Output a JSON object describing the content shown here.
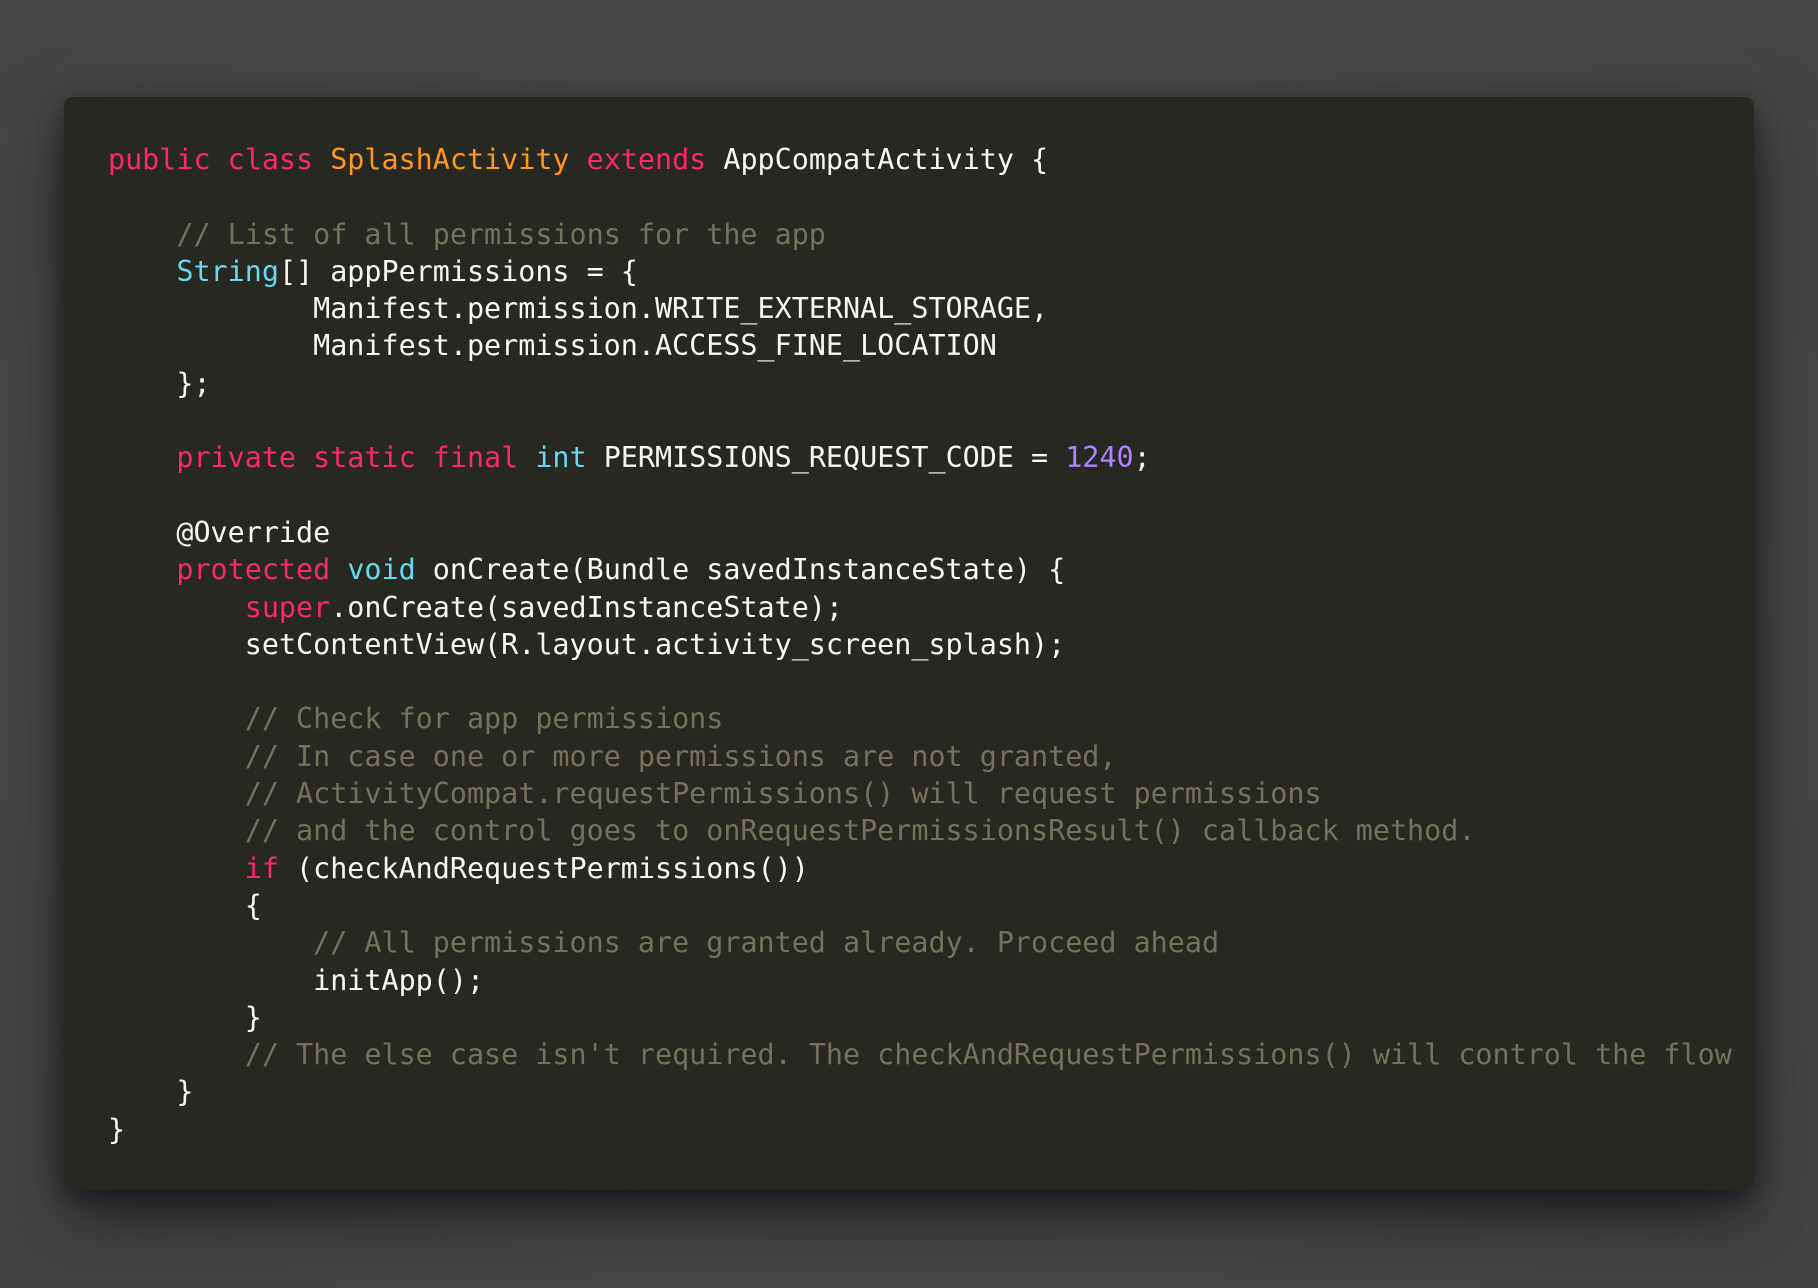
{
  "colors": {
    "background": "#4a4a4a",
    "editor_background": "#272822",
    "keyword": "#f92672",
    "class_name": "#fd971f",
    "type": "#66d9ef",
    "number": "#ae81ff",
    "comment": "#75715e",
    "plain": "#f8f8f2"
  },
  "code": {
    "language": "java",
    "lines": [
      [
        {
          "t": "kw",
          "v": "public"
        },
        {
          "t": "plain",
          "v": " "
        },
        {
          "t": "kw",
          "v": "class"
        },
        {
          "t": "plain",
          "v": " "
        },
        {
          "t": "cls",
          "v": "SplashActivity"
        },
        {
          "t": "plain",
          "v": " "
        },
        {
          "t": "kw",
          "v": "extends"
        },
        {
          "t": "plain",
          "v": " AppCompatActivity {"
        }
      ],
      [],
      [
        {
          "t": "plain",
          "v": "    "
        },
        {
          "t": "cmt",
          "v": "// List of all permissions for the app"
        }
      ],
      [
        {
          "t": "plain",
          "v": "    "
        },
        {
          "t": "typ",
          "v": "String"
        },
        {
          "t": "plain",
          "v": "[] appPermissions = {"
        }
      ],
      [
        {
          "t": "plain",
          "v": "            Manifest.permission.WRITE_EXTERNAL_STORAGE,"
        }
      ],
      [
        {
          "t": "plain",
          "v": "            Manifest.permission.ACCESS_FINE_LOCATION"
        }
      ],
      [
        {
          "t": "plain",
          "v": "    };"
        }
      ],
      [],
      [
        {
          "t": "plain",
          "v": "    "
        },
        {
          "t": "kw",
          "v": "private"
        },
        {
          "t": "plain",
          "v": " "
        },
        {
          "t": "kw",
          "v": "static"
        },
        {
          "t": "plain",
          "v": " "
        },
        {
          "t": "kw",
          "v": "final"
        },
        {
          "t": "plain",
          "v": " "
        },
        {
          "t": "typ",
          "v": "int"
        },
        {
          "t": "plain",
          "v": " PERMISSIONS_REQUEST_CODE = "
        },
        {
          "t": "num",
          "v": "1240"
        },
        {
          "t": "plain",
          "v": ";"
        }
      ],
      [],
      [
        {
          "t": "plain",
          "v": "    @Override"
        }
      ],
      [
        {
          "t": "plain",
          "v": "    "
        },
        {
          "t": "kw",
          "v": "protected"
        },
        {
          "t": "plain",
          "v": " "
        },
        {
          "t": "typ",
          "v": "void"
        },
        {
          "t": "plain",
          "v": " onCreate(Bundle savedInstanceState) {"
        }
      ],
      [
        {
          "t": "plain",
          "v": "        "
        },
        {
          "t": "kw",
          "v": "super"
        },
        {
          "t": "plain",
          "v": ".onCreate(savedInstanceState);"
        }
      ],
      [
        {
          "t": "plain",
          "v": "        setContentView(R.layout.activity_screen_splash);"
        }
      ],
      [],
      [
        {
          "t": "plain",
          "v": "        "
        },
        {
          "t": "cmt",
          "v": "// Check for app permissions"
        }
      ],
      [
        {
          "t": "plain",
          "v": "        "
        },
        {
          "t": "cmt",
          "v": "// In case one or more permissions are not granted,"
        }
      ],
      [
        {
          "t": "plain",
          "v": "        "
        },
        {
          "t": "cmt",
          "v": "// ActivityCompat.requestPermissions() will request permissions"
        }
      ],
      [
        {
          "t": "plain",
          "v": "        "
        },
        {
          "t": "cmt",
          "v": "// and the control goes to onRequestPermissionsResult() callback method."
        }
      ],
      [
        {
          "t": "plain",
          "v": "        "
        },
        {
          "t": "kw",
          "v": "if"
        },
        {
          "t": "plain",
          "v": " (checkAndRequestPermissions())"
        }
      ],
      [
        {
          "t": "plain",
          "v": "        {"
        }
      ],
      [
        {
          "t": "plain",
          "v": "            "
        },
        {
          "t": "cmt",
          "v": "// All permissions are granted already. Proceed ahead"
        }
      ],
      [
        {
          "t": "plain",
          "v": "            initApp();"
        }
      ],
      [
        {
          "t": "plain",
          "v": "        }"
        }
      ],
      [
        {
          "t": "plain",
          "v": "        "
        },
        {
          "t": "cmt",
          "v": "// The else case isn't required. The checkAndRequestPermissions() will control the flow"
        }
      ],
      [
        {
          "t": "plain",
          "v": "    }"
        }
      ],
      [
        {
          "t": "plain",
          "v": "}"
        }
      ]
    ]
  }
}
